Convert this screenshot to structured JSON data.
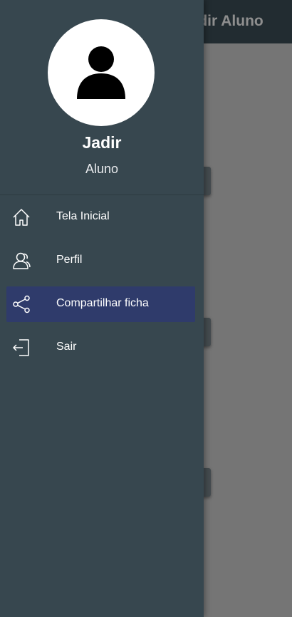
{
  "app": {
    "title": "Jadir Aluno"
  },
  "drawer": {
    "user": {
      "name": "Jadir",
      "role": "Aluno"
    },
    "items": [
      {
        "label": "Tela Inicial",
        "icon": "home-icon"
      },
      {
        "label": "Perfil",
        "icon": "users-icon"
      },
      {
        "label": "Compartilhar ficha",
        "icon": "share-icon"
      },
      {
        "label": "Sair",
        "icon": "logout-icon"
      }
    ],
    "active_item": "Compartilhar ficha"
  },
  "colors": {
    "drawer_bg": "#37474f",
    "active_bg": "#2f3b6b",
    "scrim": "rgba(0,0,0,0.38)"
  }
}
